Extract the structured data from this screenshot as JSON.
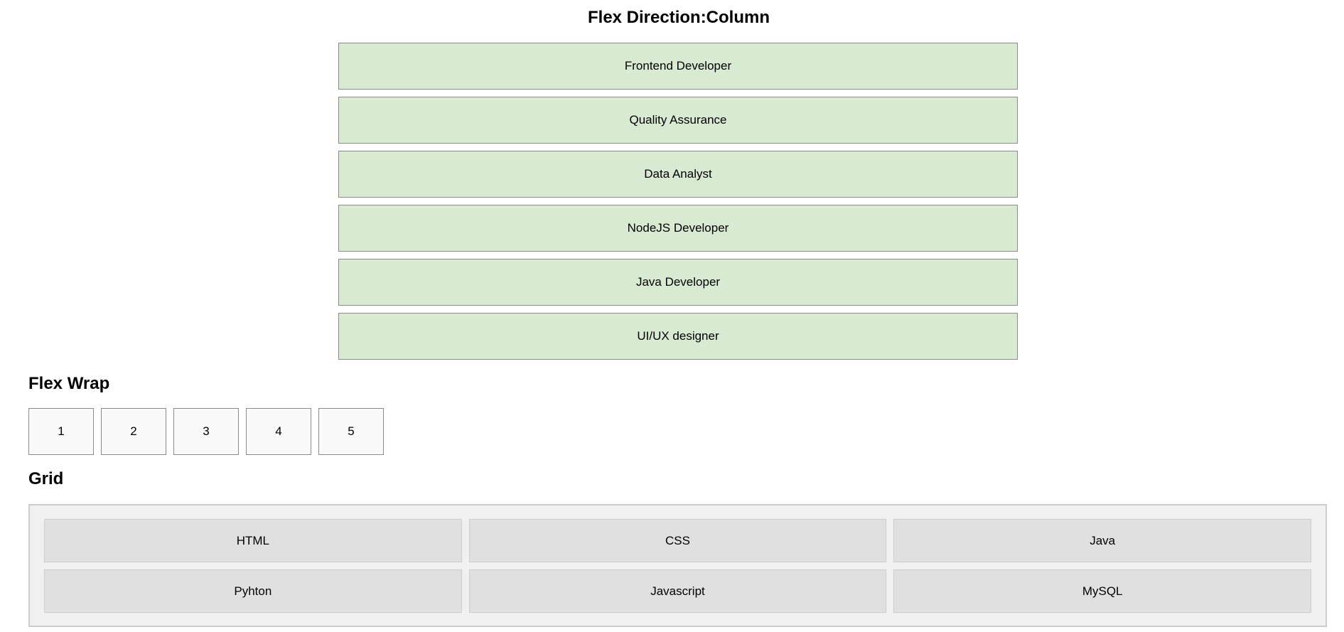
{
  "flex_section": {
    "title": "Flex Direction:Column",
    "items": [
      "Frontend Developer",
      "Quality Assurance",
      "Data Analyst",
      "NodeJS Developer",
      "Java Developer",
      "UI/UX designer"
    ]
  },
  "wrap_section": {
    "title": "Flex Wrap",
    "items": [
      "1",
      "2",
      "3",
      "4",
      "5"
    ]
  },
  "grid_section": {
    "title": "Grid",
    "items": [
      "HTML",
      "CSS",
      "Java",
      "Pyhton",
      "Javascript",
      "MySQL"
    ]
  },
  "colors": {
    "column_item_bg": "#d9ead3",
    "wrap_item_bg": "#f9f9f9",
    "grid_container_bg": "#f0f0f0",
    "grid_item_bg": "#e0e0e0"
  }
}
